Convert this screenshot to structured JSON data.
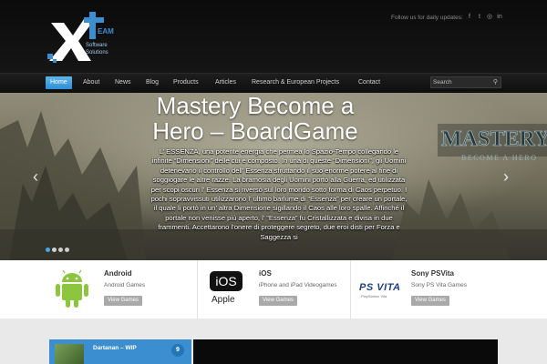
{
  "header": {
    "logo": {
      "brand": "Xteam",
      "sub1": "Software",
      "sub2": "Solutions"
    },
    "follow_text": "Follow us for daily updates:",
    "social": [
      {
        "icon": "facebook-icon",
        "glyph": "f"
      },
      {
        "icon": "twitter-icon",
        "glyph": "t"
      },
      {
        "icon": "dribbble-icon",
        "glyph": "◎"
      },
      {
        "icon": "linkedin-icon",
        "glyph": "in"
      }
    ]
  },
  "nav": {
    "items": [
      {
        "label": "Home",
        "active": true
      },
      {
        "label": "About"
      },
      {
        "label": "News"
      },
      {
        "label": "Blog"
      },
      {
        "label": "Products"
      },
      {
        "label": "Articles"
      },
      {
        "label": "Research & European Projects"
      },
      {
        "label": "Contact"
      }
    ],
    "search_placeholder": "Search"
  },
  "slider": {
    "title_line1": "Mastery Become a",
    "title_line2": "Hero – BoardGame",
    "text": "L’ ESSENZA, una potente energia che permea lo Spazio-Tempo collegando le infinite “Dimensioni” delle cui è composto. In una di queste “Dimensioni”, gli Uomini detenevano il controllo dell’ Essenza sfruttando il suo enorme potere al fine di soggiogare le altre razze. La bramosia degli Uomini portò alla Guerra, ed utilizzata per scopi oscuri l’ Essenza si riversò sul loro mondo sotto forma di Caos perpetuo. I pochi sopravvissuti utilizzarono l’ ultimo barlume di “Essenza” per creare un portale, il quale li portò in un’ altra Dimensione sigillando il Caos alle loro spalle. Affinché il portale non venisse più aperto, l’ “Essenza” fu Cristallizzata e divisa in due frammenti. Accettarono l’onere di proteggere segreto, due eroi disti per Forza e Saggezza si",
    "side_logo_text": "MASTERY",
    "side_logo_sub": "BECOME A HERO",
    "dots": 4,
    "active_dot": 0
  },
  "features": [
    {
      "title": "Android",
      "desc": "Android Games",
      "button": "View Games",
      "icon": "android-icon"
    },
    {
      "title": "iOS",
      "desc": "iPhone and iPad Videogames",
      "button": "View Games",
      "icon": "ios-apple-icon",
      "logo_text": "iOS",
      "logo_sub": "Apple"
    },
    {
      "title": "Sony PSVita",
      "desc": "Sony PS Vita Games",
      "button": "View Games",
      "icon": "psvita-icon",
      "logo_text": "PS VITA",
      "logo_sub": "PlayStation Vita"
    }
  ],
  "bottom": {
    "post_title": "Dartanan – WIP",
    "post_count": "9"
  },
  "colors": {
    "accent": "#3b8fd1",
    "nav_active": "#2d8fd6",
    "button_gray": "#a9a9a9"
  }
}
